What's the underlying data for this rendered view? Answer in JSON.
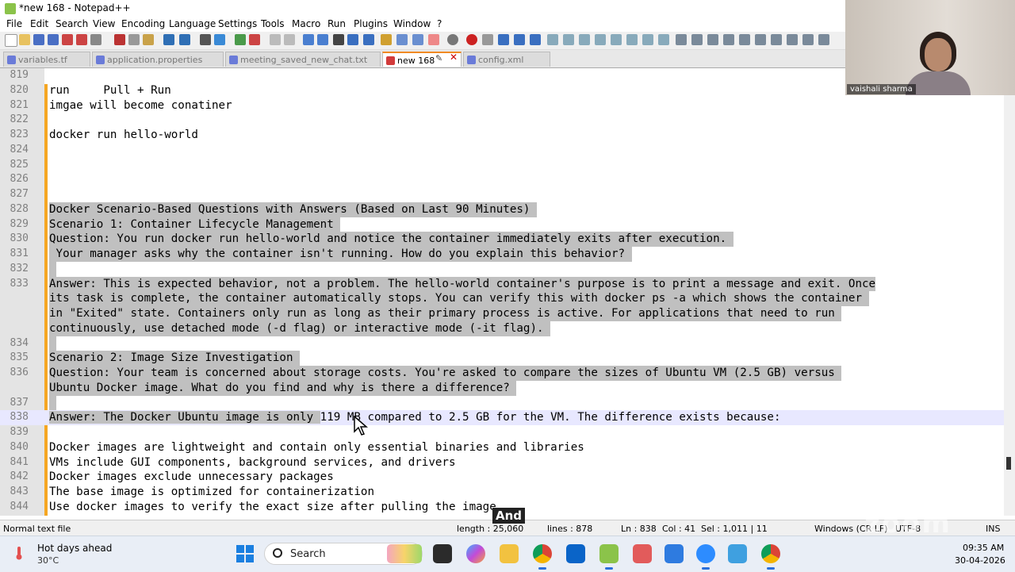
{
  "window": {
    "title": "*new 168 - Notepad++"
  },
  "menu": [
    "File",
    "Edit",
    "Search",
    "View",
    "Encoding",
    "Language",
    "Settings",
    "Tools",
    "Macro",
    "Run",
    "Plugins",
    "Window",
    "?"
  ],
  "tabs": [
    {
      "label": "variables.tf",
      "active": false
    },
    {
      "label": "application.properties",
      "active": false
    },
    {
      "label": "meeting_saved_new_chat.txt",
      "active": false
    },
    {
      "label": "new 168",
      "active": true
    },
    {
      "label": "config.xml",
      "active": false
    }
  ],
  "editor": {
    "lines": [
      {
        "n": "819",
        "text": ""
      },
      {
        "n": "820",
        "text": "run     Pull + Run"
      },
      {
        "n": "821",
        "text": "imgae will become conatiner"
      },
      {
        "n": "822",
        "text": ""
      },
      {
        "n": "823",
        "text": "docker run hello-world"
      },
      {
        "n": "824",
        "text": ""
      },
      {
        "n": "825",
        "text": ""
      },
      {
        "n": "826",
        "text": ""
      },
      {
        "n": "827",
        "text": ""
      },
      {
        "n": "828",
        "text": "Docker Scenario-Based Questions with Answers (Based on Last 90 Minutes) "
      },
      {
        "n": "829",
        "text": "Scenario 1: Container Lifecycle Management "
      },
      {
        "n": "830",
        "text": "Question: You run docker run hello-world and notice the container immediately exits after execution. "
      },
      {
        "n": "831",
        "text": " Your manager asks why the container isn't running. How do you explain this behavior? "
      },
      {
        "n": "832",
        "text": " "
      },
      {
        "n": "833",
        "text": "Answer: This is expected behavior, not a problem. The hello-world container's purpose is to print a message and exit. Once"
      },
      {
        "n": "",
        "text": "its task is complete, the container automatically stops. You can verify this with docker ps -a which shows the container "
      },
      {
        "n": "",
        "text": "in \"Exited\" state. Containers only run as long as their primary process is active. For applications that need to run "
      },
      {
        "n": "",
        "text": "continuously, use detached mode (-d flag) or interactive mode (-it flag). "
      },
      {
        "n": "834",
        "text": " "
      },
      {
        "n": "835",
        "text": "Scenario 2: Image Size Investigation "
      },
      {
        "n": "836",
        "text": "Question: Your team is concerned about storage costs. You're asked to compare the sizes of Ubuntu VM (2.5 GB) versus "
      },
      {
        "n": "",
        "text": "Ubuntu Docker image. What do you find and why is there a difference? "
      },
      {
        "n": "837",
        "text": " "
      },
      {
        "n": "838",
        "text": "Answer: The Docker Ubuntu image is only 119 MB compared to 2.5 GB for the VM. The difference exists because:"
      },
      {
        "n": "839",
        "text": ""
      },
      {
        "n": "840",
        "text": "Docker images are lightweight and contain only essential binaries and libraries"
      },
      {
        "n": "841",
        "text": "VMs include GUI components, background services, and drivers"
      },
      {
        "n": "842",
        "text": "Docker images exclude unnecessary packages"
      },
      {
        "n": "843",
        "text": "The base image is optimized for containerization"
      },
      {
        "n": "844",
        "text": "Use docker images to verify the exact size after pulling the image."
      }
    ]
  },
  "status": {
    "filetype": "Normal text file",
    "length": "length : 25,060",
    "lines": "lines : 878",
    "ln": "Ln : 838",
    "col": "Col : 41",
    "sel": "Sel : 1,011 | 11",
    "eol": "Windows (CR LF)",
    "encoding": "UTF-8",
    "mode": "INS"
  },
  "overlay": {
    "participant_name": "vaishali sharma",
    "caption": "And",
    "watermark": "zoom"
  },
  "taskbar": {
    "weather_title": "Hot days ahead",
    "weather_temp": "30°C",
    "search_label": "Search",
    "time": "09:35 AM",
    "date": "30-04-2026",
    "apps": [
      "flowers-widget-icon",
      "terminal-icon",
      "copilot-icon",
      "file-explorer-icon",
      "chrome-icon",
      "outlook-icon",
      "notepadpp-icon",
      "snipping-tool-icon",
      "microsoft-store-icon",
      "zoom-icon",
      "photos-icon",
      "chrome-alt-icon"
    ]
  },
  "colors": {
    "selection": "#c0c0c0",
    "caret_line": "#e8e8ff",
    "change_bar": "#f5a623",
    "active_tab_accent": "#f08a24"
  }
}
